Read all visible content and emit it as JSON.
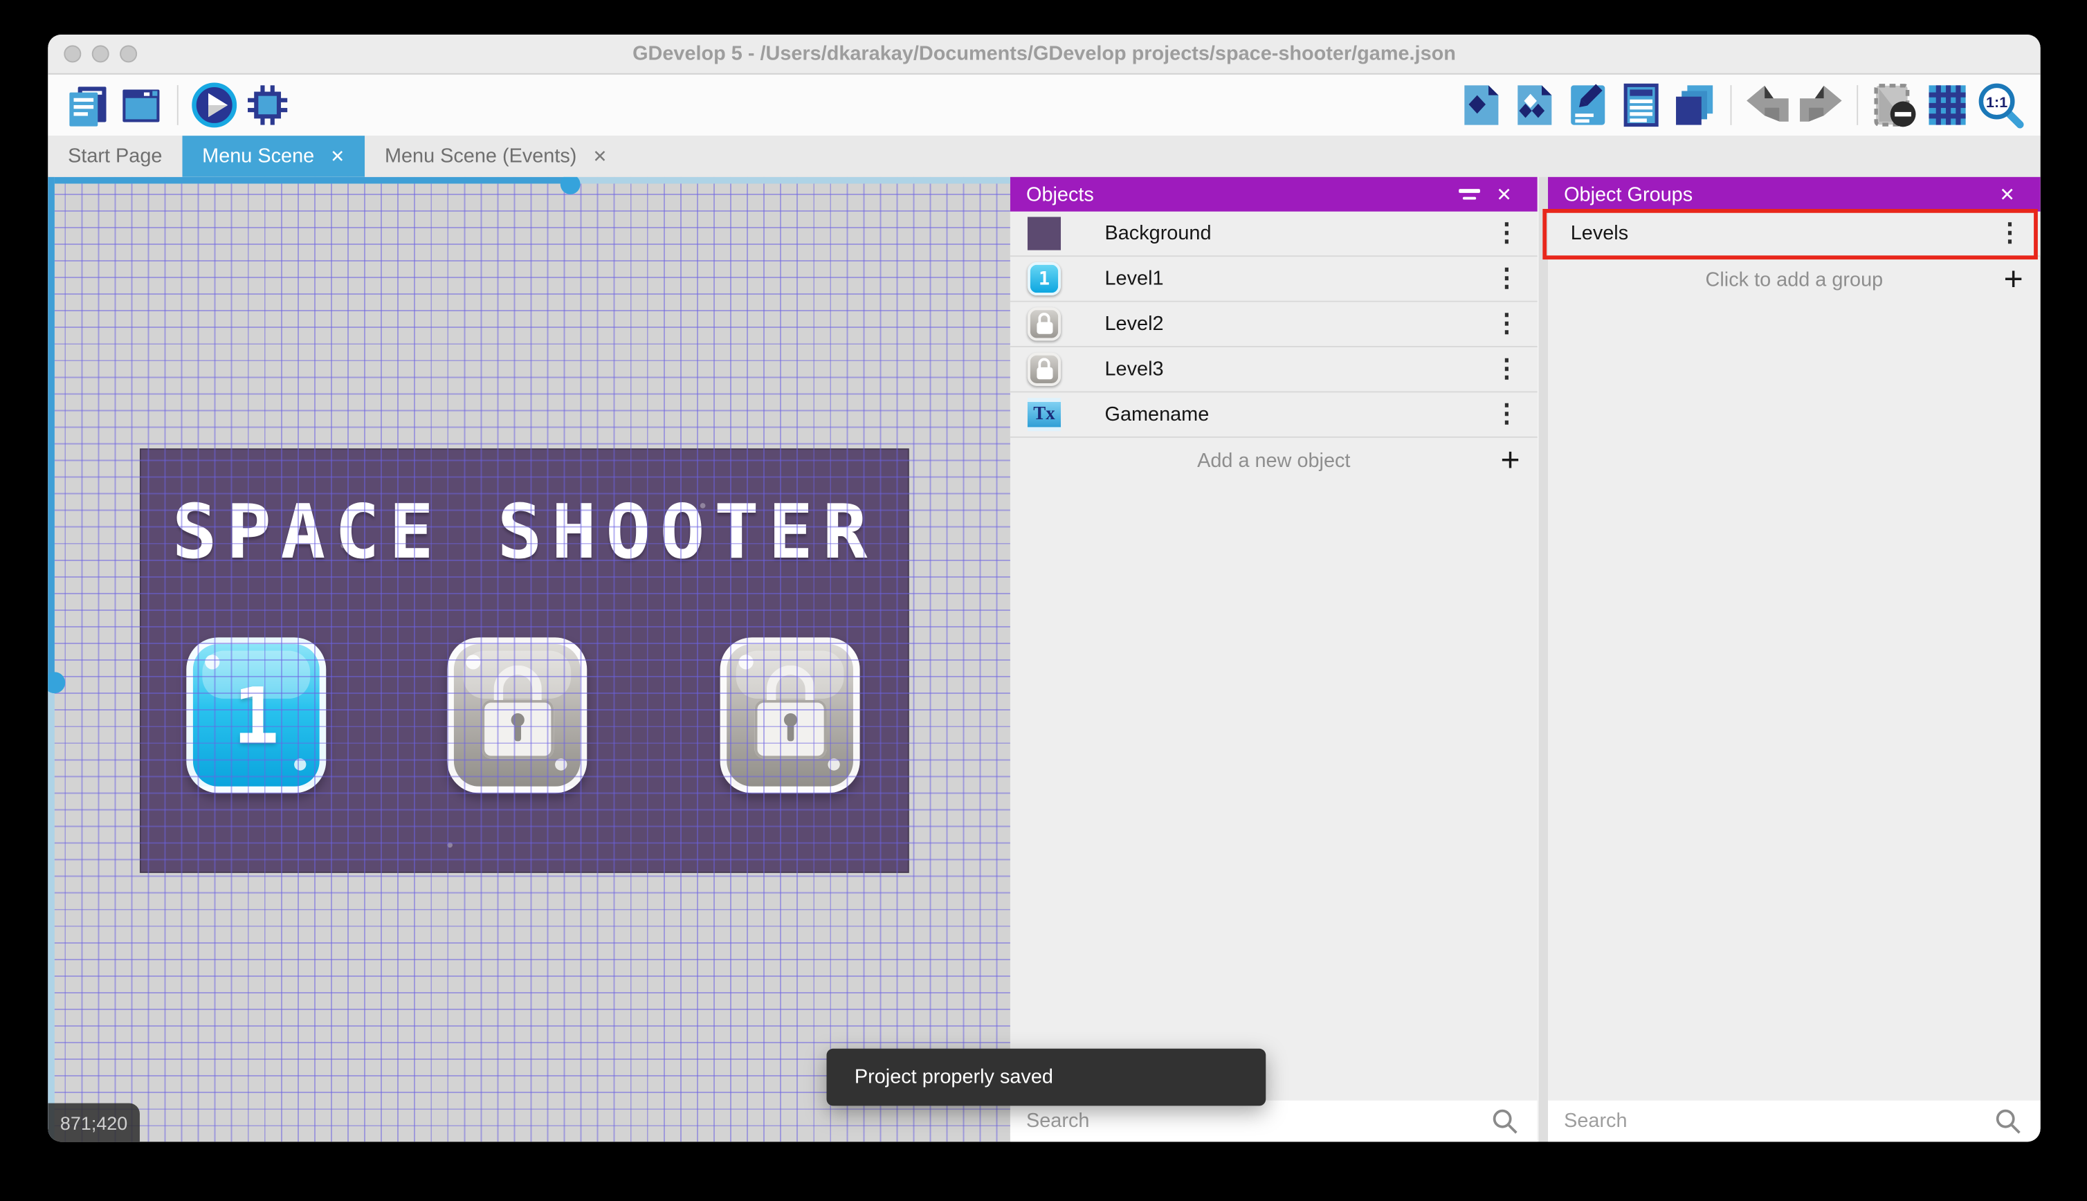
{
  "window": {
    "title": "GDevelop 5 - /Users/dkarakay/Documents/GDevelop projects/space-shooter/game.json",
    "traffic_lights": [
      "close",
      "minimize",
      "zoom"
    ]
  },
  "icons": {
    "kebab": "⋮",
    "plus": "+",
    "close": "✕",
    "tab_close": "✕"
  },
  "toolbar": {
    "left_icons": [
      "project-manager-icon",
      "scene-window-icon",
      "play-icon",
      "debug-icon"
    ],
    "right_icons": [
      "objects-panel-icon",
      "object-groups-icon",
      "properties-icon",
      "instances-list-icon",
      "layers-icon",
      "undo-icon",
      "redo-icon",
      "window-mask-icon",
      "grid-icon",
      "zoom-one-to-one-icon"
    ],
    "zoom_label": "1:1"
  },
  "tabs": [
    {
      "label": "Start Page",
      "active": false,
      "closable": false
    },
    {
      "label": "Menu Scene",
      "active": true,
      "closable": true
    },
    {
      "label": "Menu Scene (Events)",
      "active": false,
      "closable": true
    }
  ],
  "canvas": {
    "coordinates": "871;420",
    "scene": {
      "title": "SPACE SHOOTER",
      "buttons": [
        {
          "label": "1",
          "state": "unlocked"
        },
        {
          "label": "",
          "state": "locked"
        },
        {
          "label": "",
          "state": "locked"
        }
      ]
    }
  },
  "objects_panel": {
    "title": "Objects",
    "header_icons": [
      "filter-icon",
      "close-icon"
    ],
    "items": [
      {
        "name": "Background",
        "thumb": "background"
      },
      {
        "name": "Level1",
        "thumb": "button",
        "thumb_label": "1"
      },
      {
        "name": "Level2",
        "thumb": "lock"
      },
      {
        "name": "Level3",
        "thumb": "lock"
      },
      {
        "name": "Gamename",
        "thumb": "text",
        "thumb_label": "Tx"
      }
    ],
    "add_label": "Add a new object",
    "search_placeholder": "Search"
  },
  "groups_panel": {
    "title": "Object Groups",
    "header_icons": [
      "close-icon"
    ],
    "items": [
      {
        "name": "Levels",
        "highlighted": true
      }
    ],
    "add_label": "Click to add a group",
    "search_placeholder": "Search"
  },
  "toast": {
    "message": "Project properly saved"
  },
  "colors": {
    "accent_purple": "#9e1bbd",
    "accent_blue": "#42a5d8",
    "highlight_red": "#e8261b",
    "toast_bg": "#323232",
    "scene_purple": "#5c4a70",
    "canvas_gray": "#d3d3d3",
    "grid_line": "#6c62e2"
  }
}
